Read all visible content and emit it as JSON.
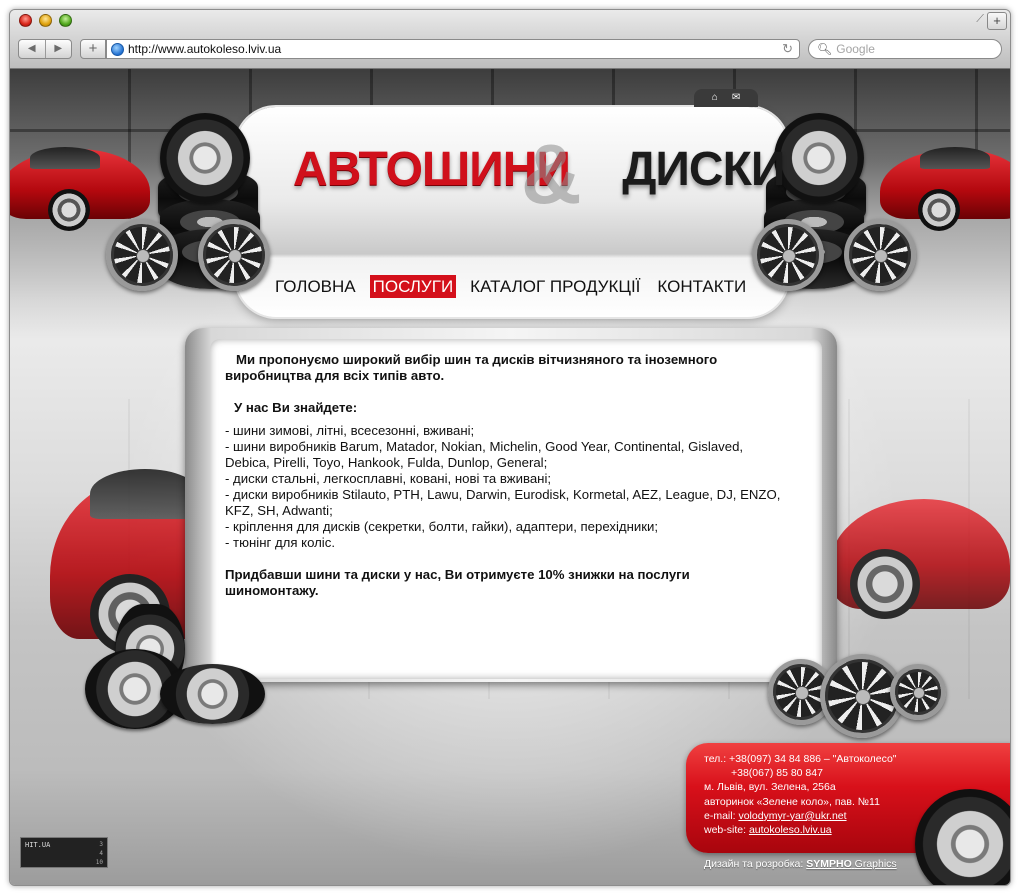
{
  "browser": {
    "url": "http://www.autokoleso.lviv.ua",
    "search_placeholder": "Google"
  },
  "header": {
    "logo_left": "АВТОШИНИ",
    "logo_amp": "&",
    "logo_right": "ДИСКИ"
  },
  "nav": {
    "items": [
      {
        "label": "ГОЛОВНА"
      },
      {
        "label": "ПОСЛУГИ"
      },
      {
        "label": "КАТАЛОГ ПРОДУКЦІЇ"
      },
      {
        "label": "КОНТАКТИ"
      }
    ],
    "active_index": 1
  },
  "content": {
    "intro": "Ми пропонуємо широкий вибір шин та дисків вітчизняного та іноземного виробництва для всіх типів авто.",
    "subhead": "У нас Ви знайдете:",
    "list": [
      "- шини зимові, літні, всесезонні, вживані;",
      "- шини виробників Barum, Matador, Nokian, Michelin, Good Year, Continental, Gislaved, Debica, Pirelli, Toyo, Hankook, Fulda, Dunlop, General;",
      "- диски стальні, легкосплавні, ковані, нові та вживані;",
      "- диски виробників Stilauto, PTH, Lawu, Darwin, Eurodisk, Kormetal, AEZ, League, DJ, ENZO, KFZ, SH, Adwanti;",
      "- кріплення для дисків (секретки, болти, гайки), адаптери, перехідники;",
      "- тюнінг для коліс."
    ],
    "outro": "Придбавши шини та диски у нас, Ви отримуєте 10% знижки на послуги шиномонтажу."
  },
  "contact": {
    "phone1": "тел.: +38(097) 34 84 886 – \"Автоколесо\"",
    "phone2": "+38(067) 85 80 847",
    "address1": "м. Львів, вул. Зелена, 256а",
    "address2": "авторинок «Зелене коло», пав. №11",
    "email_label": "e-mail:",
    "email": "volodymyr-yar@ukr.net",
    "web_label": "web-site:",
    "web": "autokoleso.lviv.ua"
  },
  "credit": {
    "prefix": "Дизайн та розробка:",
    "brand": "SYMPHO",
    "suffix": "Graphics"
  },
  "counter": {
    "title": "HIT.UA",
    "n1": "3",
    "n2": "4",
    "n3": "10"
  },
  "colors": {
    "accent_red": "#d4101b",
    "logo_dark": "#1b1b1b"
  }
}
